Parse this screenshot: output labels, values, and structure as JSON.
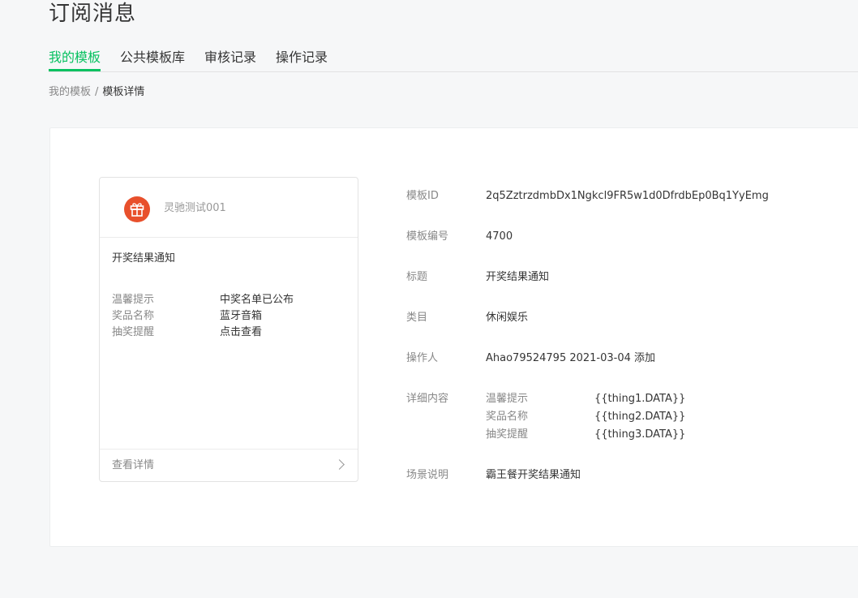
{
  "page": {
    "title": "订阅消息"
  },
  "tabs": [
    {
      "label": "我的模板",
      "active": true
    },
    {
      "label": "公共模板库",
      "active": false
    },
    {
      "label": "审核记录",
      "active": false
    },
    {
      "label": "操作记录",
      "active": false
    }
  ],
  "breadcrumb": {
    "parent": "我的模板",
    "separator": "/",
    "current": "模板详情"
  },
  "preview": {
    "brand_name": "灵驰测试001",
    "avatar_icon": "gift-icon",
    "title": "开奖结果通知",
    "fields": [
      {
        "key": "温馨提示",
        "value": "中奖名单已公布"
      },
      {
        "key": "奖品名称",
        "value": "蓝牙音箱"
      },
      {
        "key": "抽奖提醒",
        "value": "点击查看"
      }
    ],
    "footer_label": "查看详情"
  },
  "info": {
    "template_id": {
      "label": "模板ID",
      "value": "2q5ZztrzdmbDx1Ngkcl9FR5w1d0DfrdbEp0Bq1YyEmg"
    },
    "template_no": {
      "label": "模板编号",
      "value": "4700"
    },
    "title": {
      "label": "标题",
      "value": "开奖结果通知"
    },
    "category": {
      "label": "类目",
      "value": "休闲娱乐"
    },
    "operator": {
      "label": "操作人",
      "value": "Ahao79524795 2021-03-04 添加"
    },
    "detail": {
      "label": "详细内容",
      "items": [
        {
          "key": "温馨提示",
          "value": "{{thing1.DATA}}"
        },
        {
          "key": "奖品名称",
          "value": "{{thing2.DATA}}"
        },
        {
          "key": "抽奖提醒",
          "value": "{{thing3.DATA}}"
        }
      ]
    },
    "scene": {
      "label": "场景说明",
      "value": "霸王餐开奖结果通知"
    }
  },
  "colors": {
    "accent": "#07c160",
    "avatar_bg": "#e8502c"
  }
}
